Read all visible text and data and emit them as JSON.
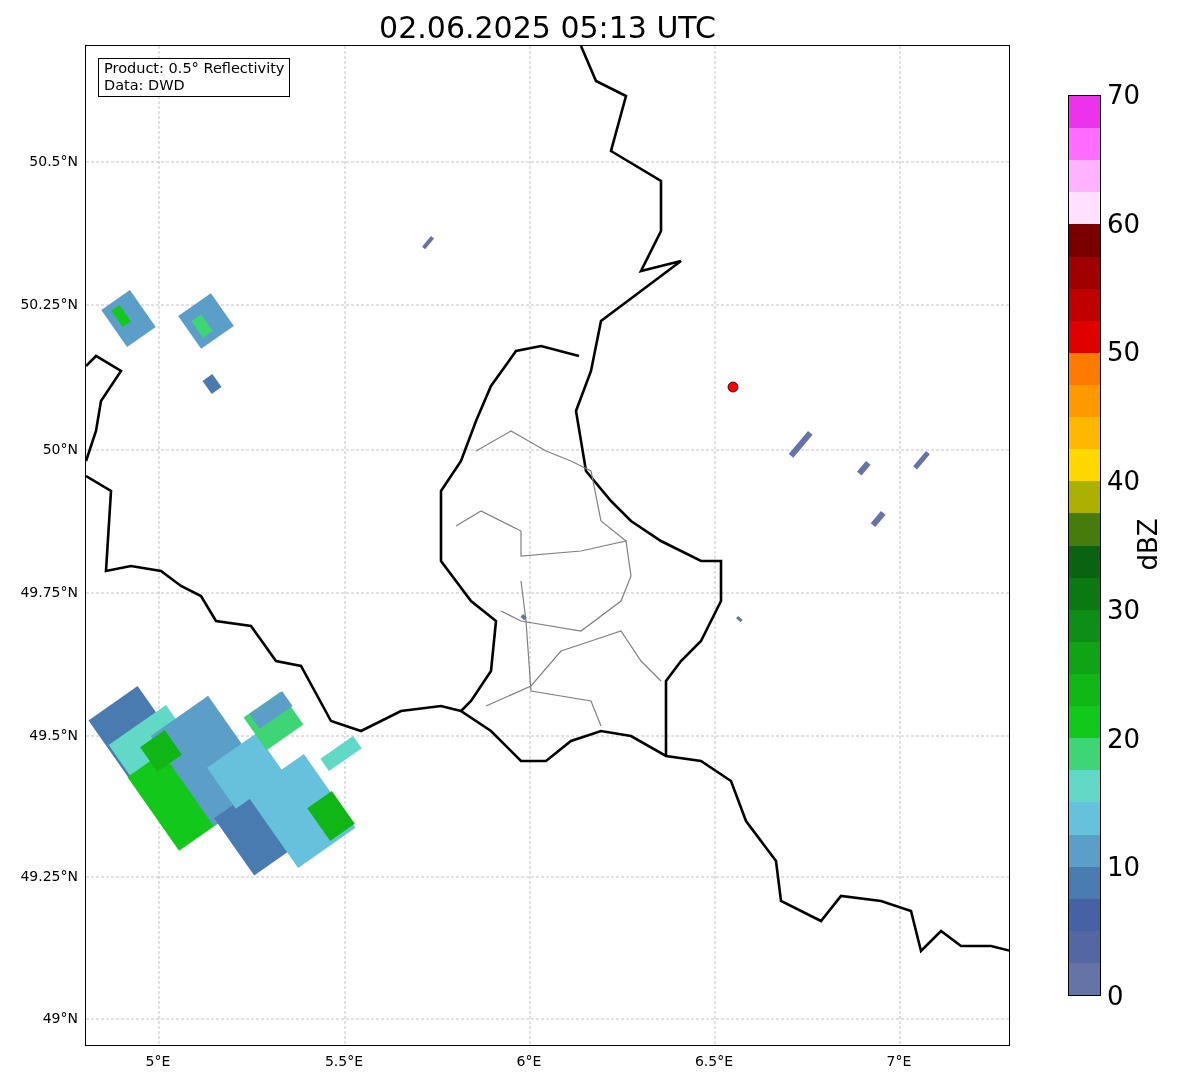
{
  "title": "02.06.2025 05:13 UTC",
  "annotation": {
    "lines": [
      "Product: 0.5° Reflectivity",
      "Data: DWD"
    ]
  },
  "map": {
    "lat_ticks": [
      "50.5°N",
      "50.25°N",
      "50°N",
      "49.75°N",
      "49.5°N",
      "49.25°N",
      "49°N"
    ],
    "lon_ticks": [
      "5°E",
      "5.5°E",
      "6°E",
      "6.5°E",
      "7°E"
    ]
  },
  "colorbar": {
    "label": "dBZ",
    "ticks": [
      "70",
      "60",
      "50",
      "40",
      "30",
      "20",
      "10",
      "0"
    ],
    "levels": [
      {
        "color": "#ea33ea"
      },
      {
        "color": "#ff6cff"
      },
      {
        "color": "#ffb3ff"
      },
      {
        "color": "#ffe0ff"
      },
      {
        "color": "#7a0000"
      },
      {
        "color": "#9f0000"
      },
      {
        "color": "#c00000"
      },
      {
        "color": "#e00000"
      },
      {
        "color": "#ff7a00"
      },
      {
        "color": "#ff9900"
      },
      {
        "color": "#ffb700"
      },
      {
        "color": "#ffd800"
      },
      {
        "color": "#acb000"
      },
      {
        "color": "#467c0c"
      },
      {
        "color": "#0a6310"
      },
      {
        "color": "#0b7812"
      },
      {
        "color": "#0e8e16"
      },
      {
        "color": "#10a315"
      },
      {
        "color": "#10b615"
      },
      {
        "color": "#12c81a"
      },
      {
        "color": "#3ed574"
      },
      {
        "color": "#62d8c6"
      },
      {
        "color": "#66c2dc"
      },
      {
        "color": "#5b9fc8"
      },
      {
        "color": "#4a7bb0"
      },
      {
        "color": "#4661a3"
      },
      {
        "color": "#5567a2"
      },
      {
        "color": "#6673a6"
      }
    ]
  }
}
